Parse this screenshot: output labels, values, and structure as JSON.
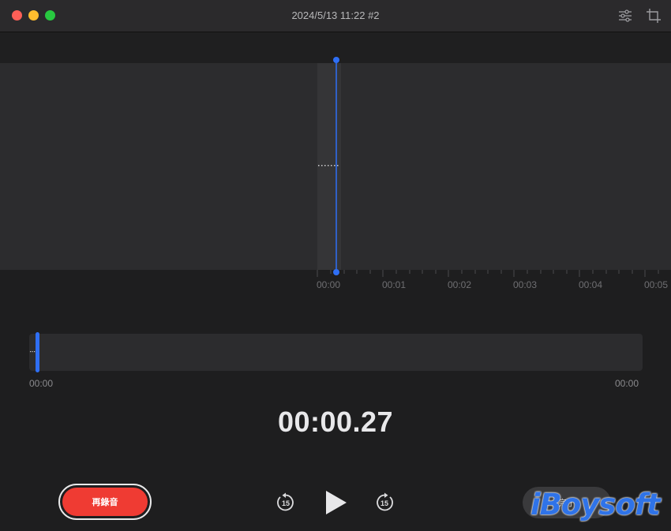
{
  "window": {
    "title": "2024/5/13 11:22 #2"
  },
  "toolbar": {
    "icons": [
      "sliders-icon",
      "crop-icon"
    ]
  },
  "waveform": {
    "ruler_labels": [
      "00:00",
      "00:01",
      "00:02",
      "00:03",
      "00:04",
      "00:05"
    ],
    "playhead_color": "#2f6ff5"
  },
  "overview": {
    "start_time": "00:00",
    "end_time": "00:00"
  },
  "timer": {
    "current": "00:00.27"
  },
  "controls": {
    "rerecord_label": "再錄音",
    "skip_back_seconds": "15",
    "skip_forward_seconds": "15",
    "done_label": "完了"
  },
  "watermark": {
    "text": "iBoysoft"
  }
}
